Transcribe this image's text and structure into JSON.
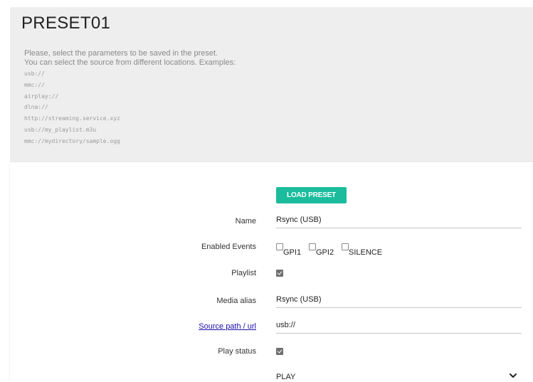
{
  "header": {
    "title": "PRESET01",
    "description_line1": "Please, select the parameters to be saved in the preset.",
    "description_line2": "You can select the source from different locations. Examples:",
    "examples": [
      "usb://",
      "mmc://",
      "airplay://",
      "dlna://",
      "http://streaming.service.xyz",
      "usb://my_playlist.m3u",
      "mmc://mydirectory/sample.ogg"
    ]
  },
  "form": {
    "load_button_label": "LOAD PRESET",
    "name_label": "Name",
    "name_value": "Rsync (USB)",
    "enabled_events_label": "Enabled Events",
    "events": [
      {
        "label": "GPI1",
        "checked": false
      },
      {
        "label": "GPI2",
        "checked": false
      },
      {
        "label": "SILENCE",
        "checked": false
      }
    ],
    "playlist_label": "Playlist",
    "playlist_checked": true,
    "media_alias_label": "Media alias",
    "media_alias_value": "Rsync (USB)",
    "source_path_label": "Source path / url",
    "source_path_value": "usb://",
    "play_status_label": "Play status",
    "play_status_checked": true,
    "play_select_value": "PLAY"
  },
  "colors": {
    "accent": "#1abc9c",
    "header_background": "#eeeeee",
    "link": "#1a0dab"
  },
  "icons": {
    "select_arrow": "chevron-down-icon"
  }
}
